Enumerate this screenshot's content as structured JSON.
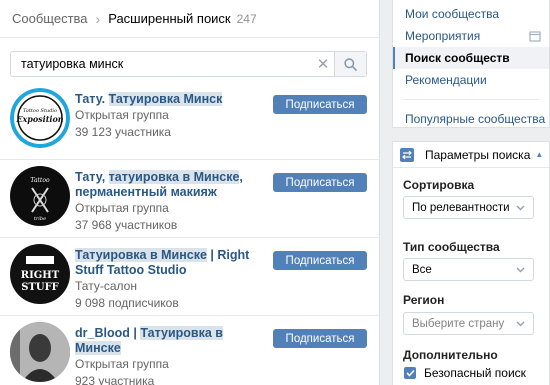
{
  "header": {
    "breadcrumb_root": "Сообщества",
    "title": "Расширенный поиск",
    "count": "247"
  },
  "search": {
    "value": "татуировка минск"
  },
  "results": [
    {
      "name_plain": "Тату. ",
      "name_hl": "Татуировка Минск",
      "name_rest": "",
      "type": "Открытая группа",
      "members": "39 123 участника",
      "button": "Подписаться"
    },
    {
      "name_plain": "Тату, ",
      "name_hl": "татуировка в Минске",
      "name_rest": ", перманентный макияж",
      "type": "Открытая группа",
      "members": "37 968 участников",
      "button": "Подписаться"
    },
    {
      "name_plain": "",
      "name_hl": "Татуировка в Минске",
      "name_rest": " | Right Stuff Tattoo Studio",
      "type": "Тату-салон",
      "members": "9 098 подписчиков",
      "button": "Подписаться"
    },
    {
      "name_plain": "dr_Blood | ",
      "name_hl": "Татуировка в Минске",
      "name_rest": "",
      "type": "Открытая группа",
      "members": "923 участника",
      "button": "Подписаться"
    }
  ],
  "avatars": {
    "a1_line1": "Tattoo Studio",
    "a1_line2": "Exposition",
    "a2_line1": "Tattoo",
    "a2_line2": "tribe",
    "a3_line1": "RIGHT",
    "a3_line2": "STUFF"
  },
  "menu": {
    "items": [
      "Мои сообщества",
      "Мероприятия",
      "Поиск сообществ",
      "Рекомендации"
    ],
    "popular": "Популярные сообщества"
  },
  "filters": {
    "title": "Параметры поиска",
    "sort_label": "Сортировка",
    "sort_value": "По релевантности",
    "type_label": "Тип сообщества",
    "type_value": "Все",
    "region_label": "Регион",
    "region_placeholder": "Выберите страну",
    "extra_label": "Дополнительно",
    "safe_search": "Безопасный поиск"
  },
  "colors": {
    "accent": "#5181b8",
    "link": "#2a5885",
    "highlight": "#dae2ea",
    "bg": "#edeef0"
  }
}
